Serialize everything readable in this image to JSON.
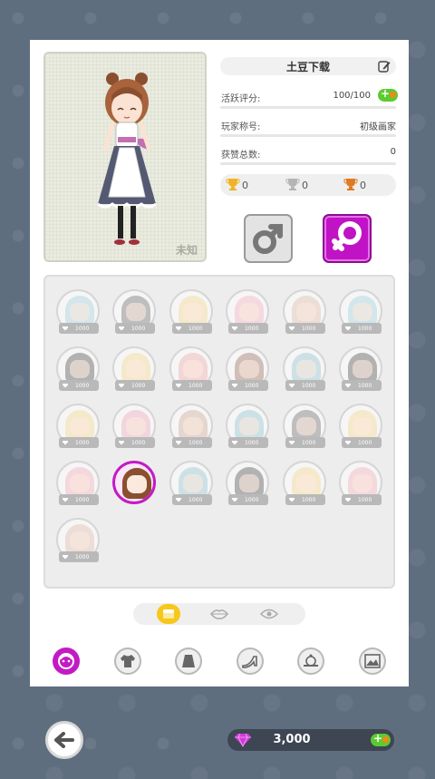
{
  "portrait": {
    "tag": "未知"
  },
  "profile": {
    "name": "土豆下载",
    "activity_label": "活跃评分:",
    "activity_value": "100/100",
    "title_label": "玩家称号:",
    "title_value": "初级画家",
    "likes_label": "获赞总数:",
    "likes_value": "0"
  },
  "trophies": [
    {
      "name": "gold",
      "count": "0",
      "color": "#f0b323"
    },
    {
      "name": "silver",
      "count": "0",
      "color": "#b5b5b5"
    },
    {
      "name": "bronze",
      "count": "0",
      "color": "#e07a22"
    }
  ],
  "gender": {
    "selected": "female",
    "accent": "#c013c5"
  },
  "items": [
    {
      "price": "1000",
      "hair": "#8fc9d8"
    },
    {
      "price": "1000",
      "hair": "#555"
    },
    {
      "price": "1000",
      "hair": "#f4d27a"
    },
    {
      "price": "1000",
      "hair": "#f2a3b8"
    },
    {
      "price": "1000",
      "hair": "#d9b09a"
    },
    {
      "price": "1000",
      "hair": "#8fc9d8"
    },
    {
      "price": "1000",
      "hair": "#333"
    },
    {
      "price": "1000",
      "hair": "#f4d27a"
    },
    {
      "price": "1000",
      "hair": "#ee9b9b"
    },
    {
      "price": "1000",
      "hair": "#8a5a44"
    },
    {
      "price": "1000",
      "hair": "#7fb9c9"
    },
    {
      "price": "1000",
      "hair": "#333"
    },
    {
      "price": "1000",
      "hair": "#f4d27a"
    },
    {
      "price": "1000",
      "hair": "#ee9bb0"
    },
    {
      "price": "1000",
      "hair": "#c89c8a"
    },
    {
      "price": "1000",
      "hair": "#7fb9c9"
    },
    {
      "price": "1000",
      "hair": "#555"
    },
    {
      "price": "1000",
      "hair": "#f4d27a"
    },
    {
      "price": "1000",
      "hair": "#f0a0b0"
    },
    {
      "price": "",
      "hair": "#8a4f2e",
      "selected": true
    },
    {
      "price": "1000",
      "hair": "#7fb9c9"
    },
    {
      "price": "1000",
      "hair": "#333"
    },
    {
      "price": "1000",
      "hair": "#f4d27a"
    },
    {
      "price": "1000",
      "hair": "#f0a0b0"
    },
    {
      "price": "1000",
      "hair": "#d9b09a"
    }
  ],
  "sub_tabs": [
    "comb-icon",
    "lips-icon",
    "eye-icon"
  ],
  "categories": [
    "face-icon",
    "top-icon",
    "skirt-icon",
    "shoe-icon",
    "accessory-icon",
    "background-icon"
  ],
  "currency": {
    "amount": "3,000"
  }
}
